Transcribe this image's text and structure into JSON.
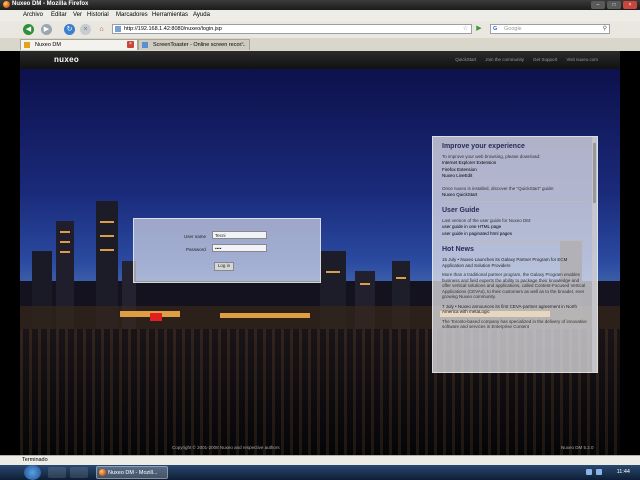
{
  "window": {
    "title": "Nuxeo DM - Mozilla Firefox",
    "controls": [
      "–",
      "□",
      "×"
    ]
  },
  "menu": [
    "Archivo",
    "Editar",
    "Ver",
    "Historial",
    "Marcadores",
    "Herramientas",
    "Ayuda"
  ],
  "nav": {
    "url": "http://192.168.1.42:8080/nuxeo/login.jsp",
    "search_placeholder": "Google"
  },
  "tabs": [
    {
      "label": "Nuxeo DM"
    },
    {
      "label": "ScreenToaster - Online screen recor..."
    }
  ],
  "page": {
    "logo": "nuxeo",
    "top_links": [
      "QuickStart",
      "Join the community",
      "Get Support",
      "Visit nuxeo.com"
    ],
    "login": {
      "username_label": "User name",
      "username_value": "Tecni",
      "password_label": "Password",
      "password_value": "••••",
      "submit": "Log in"
    },
    "side": {
      "improve_title": "Improve your experience",
      "improve_text": "To improve your web browsing, please download:",
      "improve_links": [
        "Internet Explorer Extension",
        "Firefox Extension",
        "Nuxeo LiveEdit"
      ],
      "improve_text2": "Once nuxeo is installed, discover the \"QuickStart\" guide:",
      "improve_link2": "Nuxeo QuickStart",
      "guide_title": "User Guide",
      "guide_text": "Last version of the user guide for Nuxeo DM:",
      "guide_links": [
        "user guide in one HTML page",
        "user guide in paginated html pages"
      ],
      "news_title": "Hot News",
      "news1_head": "15 July • Nuxeo Launches its Galaxy Partner Program for ECM Application and Solution Providers",
      "news1_body": "More than a traditional partner program, the Galaxy Program enables business and field experts the ability to package their knowledge and offer vertical solutions and applications, called Content-Focused Vertical Applications (CEVAs), to their customers as well as to the broader, ever growing Nuxeo community.",
      "news2_head": "7 July • Nuxeo announces its first CEVA-partner agreement in North America with metaLogic",
      "news2_body": "The Toronto-based company has specialized in the delivery of innovative software and services in Enterprise Content"
    },
    "footer_left": "Copyright © 2001-2008 Nuxeo and respective authors",
    "footer_right": "Nuxeo DM   5.2.0"
  },
  "status": "Terminado",
  "taskbar": {
    "task": "Nuxeo DM - Mozill...",
    "clock": "11:44"
  }
}
